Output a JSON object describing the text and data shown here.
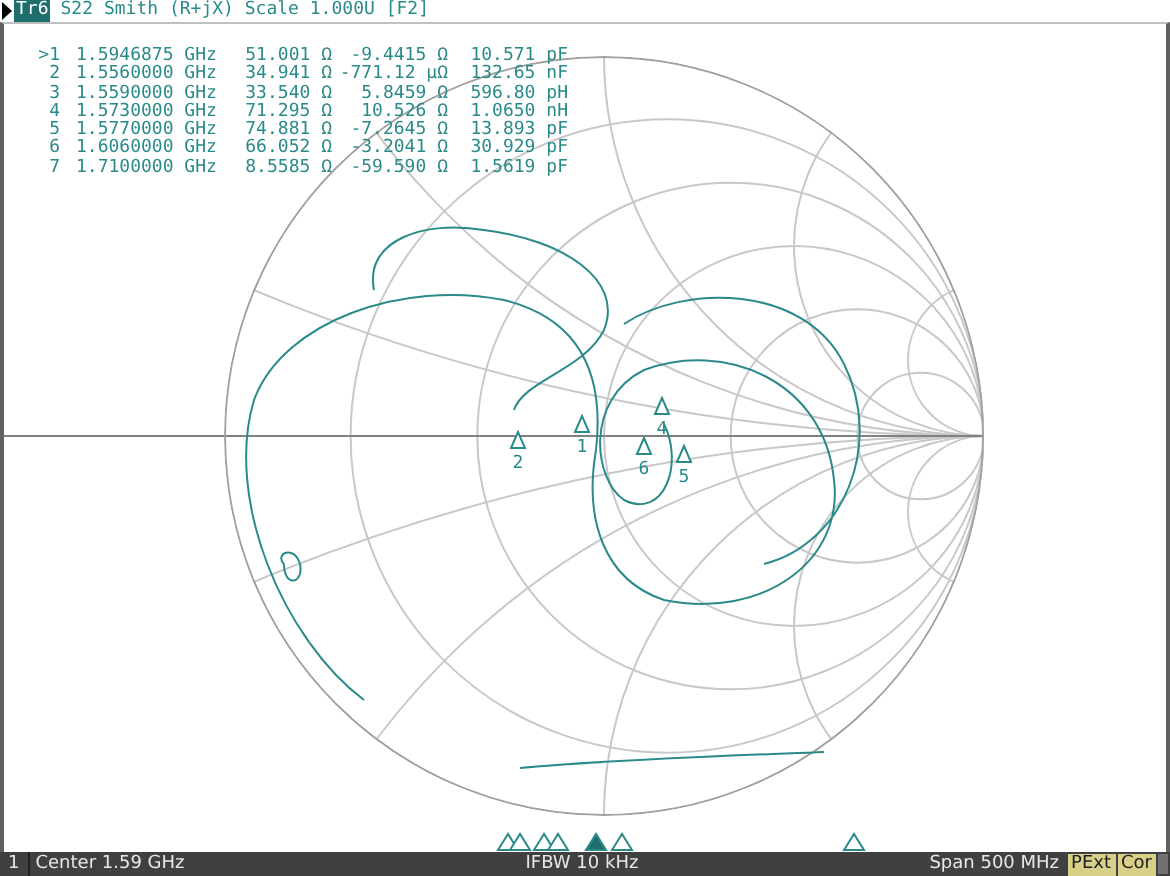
{
  "trace": {
    "tag": "Tr6",
    "title": "S22 Smith (R+jX) Scale 1.000U [F2]"
  },
  "markers": [
    {
      "label": ">1",
      "frequency": "1.5946875 GHz",
      "resistance": "51.001 Ω",
      "reactance": "-9.4415 Ω",
      "equivalent": "10.571 pF"
    },
    {
      "label": "2",
      "frequency": "1.5560000 GHz",
      "resistance": "34.941 Ω",
      "reactance": "-771.12 µΩ",
      "equivalent": "132.65 nF"
    },
    {
      "label": "3",
      "frequency": "1.5590000 GHz",
      "resistance": "33.540 Ω",
      "reactance": "5.8459 Ω",
      "equivalent": "596.80 pH"
    },
    {
      "label": "4",
      "frequency": "1.5730000 GHz",
      "resistance": "71.295 Ω",
      "reactance": "10.526 Ω",
      "equivalent": "1.0650 nH"
    },
    {
      "label": "5",
      "frequency": "1.5770000 GHz",
      "resistance": "74.881 Ω",
      "reactance": "-7.2645 Ω",
      "equivalent": "13.893 pF"
    },
    {
      "label": "6",
      "frequency": "1.6060000 GHz",
      "resistance": "66.052 Ω",
      "reactance": "-3.2041 Ω",
      "equivalent": "30.929 pF"
    },
    {
      "label": "7",
      "frequency": "1.7100000 GHz",
      "resistance": "8.5585 Ω",
      "reactance": "-59.590 Ω",
      "equivalent": "1.5619 pF"
    }
  ],
  "chart_markers": [
    {
      "label": "1"
    },
    {
      "label": "2"
    },
    {
      "label": "4"
    },
    {
      "label": "6"
    },
    {
      "label": "5"
    }
  ],
  "stimulus_markers": [
    {
      "selected": false
    },
    {
      "selected": false
    },
    {
      "selected": false
    },
    {
      "selected": false
    },
    {
      "selected": true
    },
    {
      "selected": false
    },
    {
      "selected": false
    }
  ],
  "status_bar": {
    "channel": "1",
    "center": "Center 1.59 GHz",
    "ifbw": "IFBW 10 kHz",
    "span": "Span 500 MHz",
    "badges": [
      "PExt",
      "Cor"
    ]
  }
}
